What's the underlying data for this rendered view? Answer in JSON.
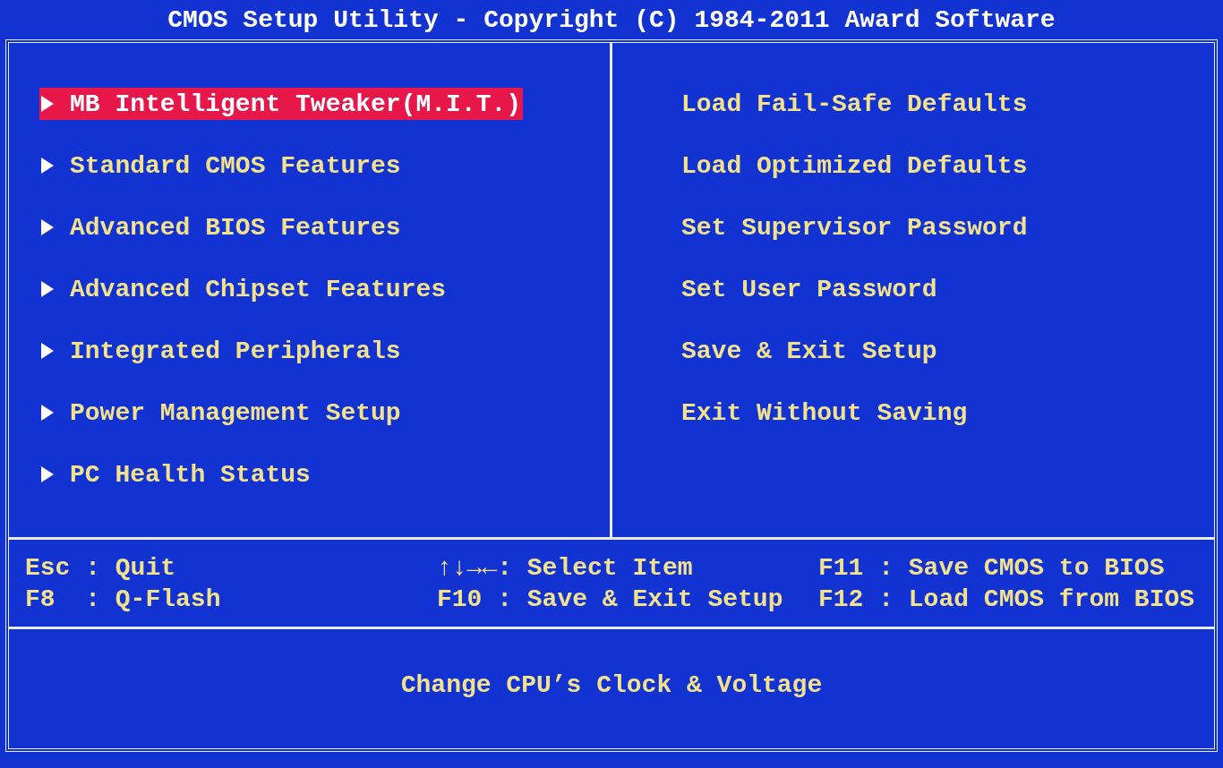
{
  "title": "CMOS Setup Utility - Copyright (C) 1984-2011 Award Software",
  "left_menu": [
    {
      "label": "MB Intelligent Tweaker(M.I.T.)",
      "selected": true
    },
    {
      "label": "Standard CMOS Features",
      "selected": false
    },
    {
      "label": "Advanced BIOS Features",
      "selected": false
    },
    {
      "label": "Advanced Chipset Features",
      "selected": false
    },
    {
      "label": "Integrated Peripherals",
      "selected": false
    },
    {
      "label": "Power Management Setup",
      "selected": false
    },
    {
      "label": "PC Health Status",
      "selected": false
    }
  ],
  "right_menu": [
    {
      "label": "Load Fail-Safe Defaults",
      "selected": false
    },
    {
      "label": "Load Optimized Defaults",
      "selected": false
    },
    {
      "label": "Set Supervisor Password",
      "selected": false
    },
    {
      "label": "Set User Password",
      "selected": false
    },
    {
      "label": "Save & Exit Setup",
      "selected": false
    },
    {
      "label": "Exit Without Saving",
      "selected": false
    }
  ],
  "key_help": [
    [
      "Esc : Quit",
      "F8  : Q-Flash"
    ],
    [
      "↑↓→←: Select Item",
      "F10 : Save & Exit Setup"
    ],
    [
      "F11 : Save CMOS to BIOS",
      "F12 : Load CMOS from BIOS"
    ]
  ],
  "status_line": "Change CPU’s Clock & Voltage"
}
